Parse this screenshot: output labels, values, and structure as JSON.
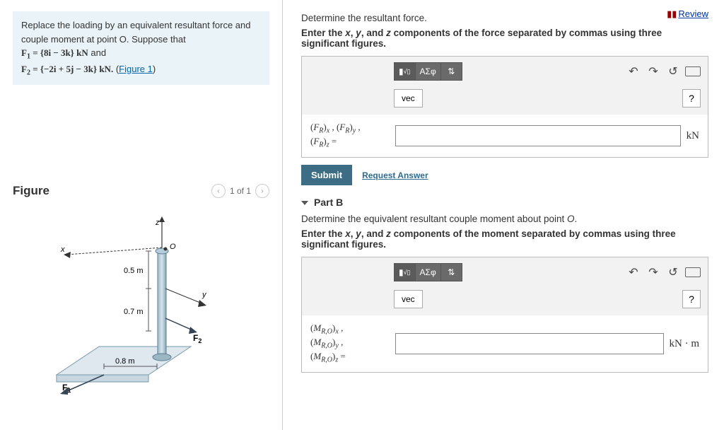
{
  "problem": {
    "intro": "Replace the loading by an equivalent resultant force and couple moment at point O. Suppose that",
    "f1": "F₁ = {8i − 3k} kN and",
    "f2_prefix": "F₂ = {−2i + 5j − 3k} kN. (",
    "figure_link": "Figure 1",
    "f2_suffix": ")"
  },
  "figure": {
    "title": "Figure",
    "pager": "1 of 1",
    "dim_top": "0.5 m",
    "dim_mid": "0.7 m",
    "dim_bot": "0.8 m"
  },
  "review": "Review",
  "partA": {
    "line1": "Determine the resultant force.",
    "line2": "Enter the x, y, and z components of the force separated by commas using three significant figures.",
    "toolbar": {
      "templates": "▭√▭",
      "greek": "ΑΣφ",
      "updown": "⇅",
      "vec": "vec"
    },
    "eq_label": "(F_R)_x , (F_R)_y , (F_R)_z =",
    "unit": "kN",
    "submit": "Submit",
    "request": "Request Answer"
  },
  "partB": {
    "header": "Part B",
    "line1": "Determine the equivalent resultant couple moment about point O.",
    "line2": "Enter the x, y, and z components of the moment separated by commas using three significant figures.",
    "toolbar": {
      "templates": "▭√▭",
      "greek": "ΑΣφ",
      "updown": "⇅",
      "vec": "vec"
    },
    "eq_label": "(M_{R,O})_x , (M_{R,O})_y , (M_{R,O})_z =",
    "unit": "kN · m"
  }
}
